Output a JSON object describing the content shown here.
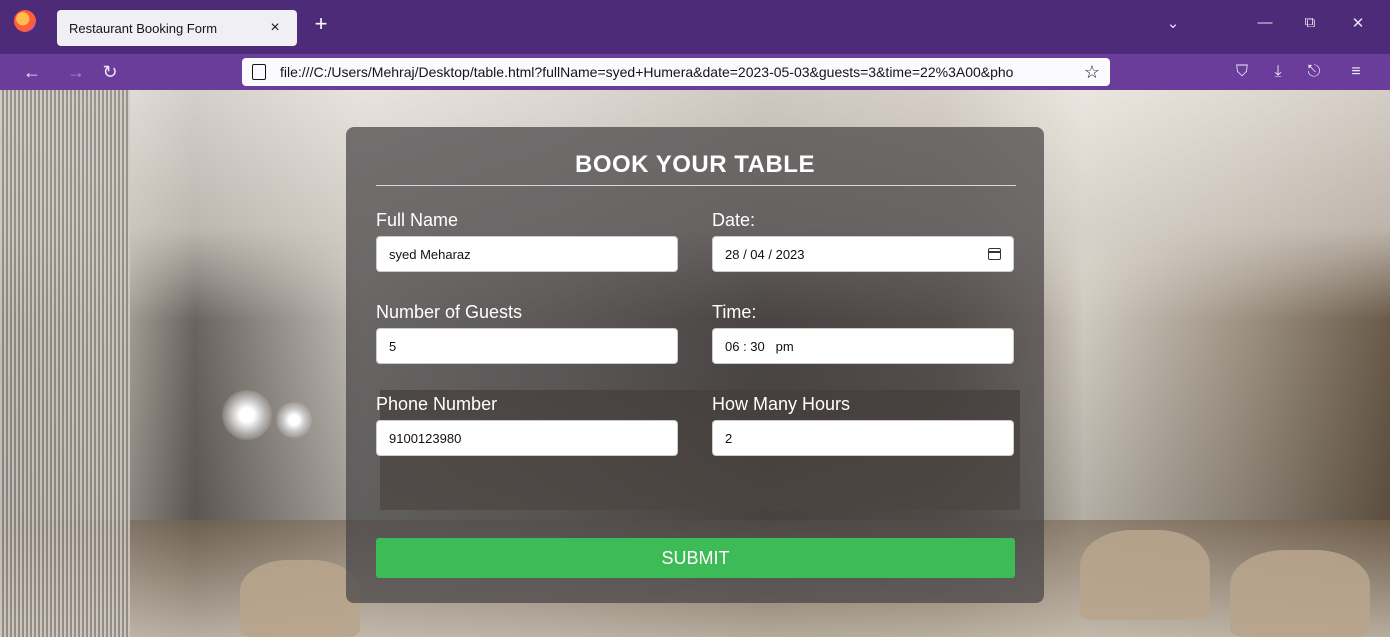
{
  "browser": {
    "tab_title": "Restaurant Booking Form",
    "tab_close": "×",
    "new_tab": "+",
    "url": "file:///C:/Users/Mehraj/Desktop/table.html?fullName=syed+Humera&date=2023-05-03&guests=3&time=22%3A00&pho",
    "window_controls": {
      "list": "⌄",
      "minimize": "—",
      "restore": "⧉",
      "close": "✕"
    },
    "nav": {
      "back": "←",
      "forward": "→",
      "reload": "↻",
      "bookmark": "☆"
    },
    "toolbar": {
      "pocket": "⛉",
      "download": "⤓",
      "share": "⎋",
      "menu": "≡"
    }
  },
  "form": {
    "title": "BOOK YOUR TABLE",
    "fields": {
      "full_name": {
        "label": "Full Name",
        "value": "syed Meharaz"
      },
      "date": {
        "label": "Date:",
        "value": "28 / 04 / 2023"
      },
      "guests": {
        "label": "Number of Guests",
        "value": "5"
      },
      "time": {
        "label": "Time:",
        "value": "06 : 30   pm"
      },
      "phone": {
        "label": "Phone Number",
        "value": "9100123980"
      },
      "hours": {
        "label": "How Many Hours",
        "value": "2"
      }
    },
    "submit_label": "SUBMIT"
  },
  "colors": {
    "tabbar": "#4e2b78",
    "navbar": "#6a3d9a",
    "submit": "#3dbb57"
  }
}
